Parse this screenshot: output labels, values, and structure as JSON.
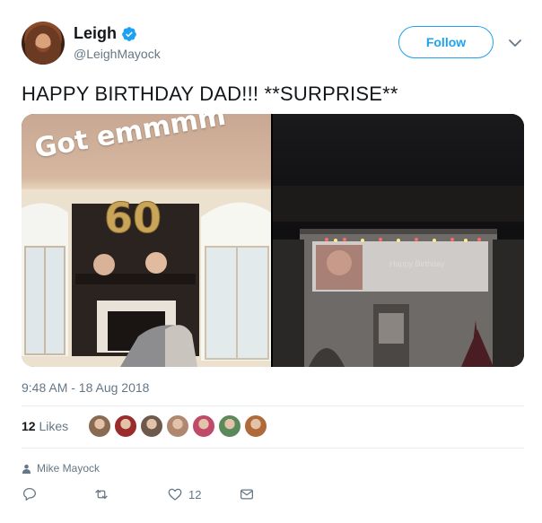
{
  "user": {
    "display_name": "Leigh",
    "handle": "@LeighMayock",
    "verified": true
  },
  "follow_button": {
    "label": "Follow"
  },
  "tweet": {
    "text": "HAPPY BIRTHDAY DAD!!! **SURPRISE**",
    "timestamp": "9:48 AM - 18 Aug 2018",
    "media": {
      "left_photo_overlay": "Got emmmm",
      "left_photo_balloons": "60",
      "right_photo_banner": "Happy Birthday"
    }
  },
  "likes": {
    "count": "12",
    "label": "Likes",
    "avatars": [
      "#8a6b52",
      "#9b2c2c",
      "#6d5a4c",
      "#b08870",
      "#c04a6a",
      "#5a8a5a",
      "#b06a3a"
    ]
  },
  "context": {
    "icon": "person-icon",
    "name": "Mike Mayock"
  },
  "actions": {
    "reply_icon": "reply-icon",
    "retweet_icon": "retweet-icon",
    "like_icon": "heart-icon",
    "like_count": "12",
    "dm_icon": "envelope-icon"
  },
  "colors": {
    "accent": "#1da1f2",
    "text": "#14171a",
    "muted": "#657786",
    "border": "#e6ecf0"
  }
}
